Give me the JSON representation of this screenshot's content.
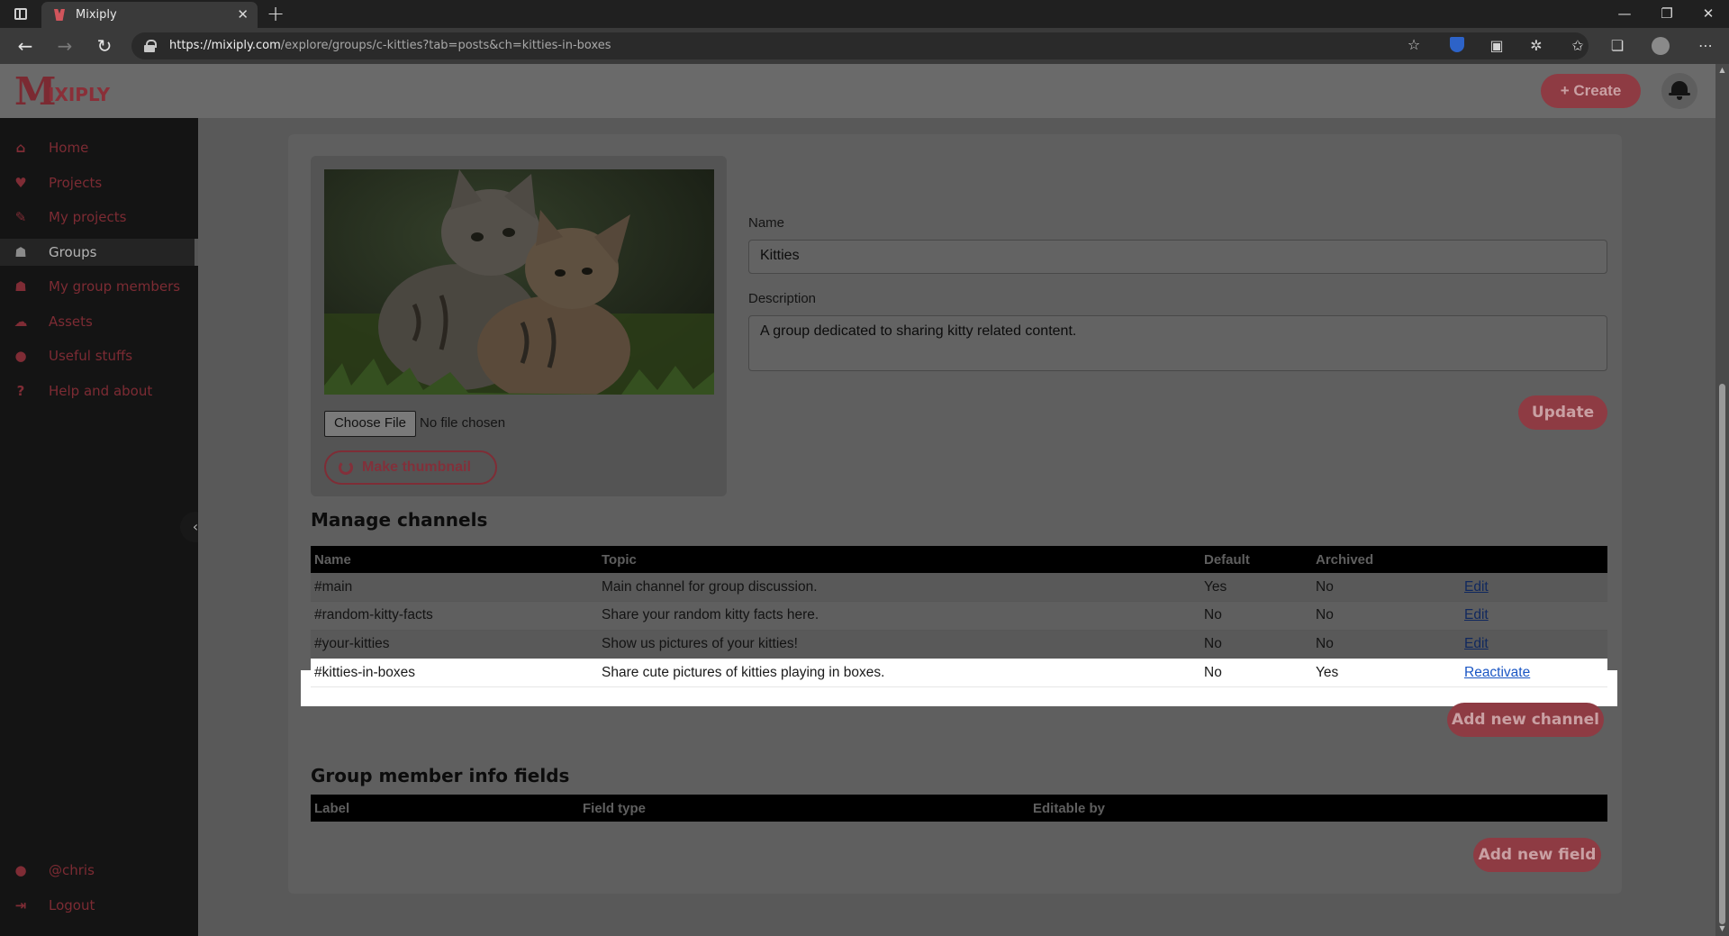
{
  "browser": {
    "tab_title": "Mixiply",
    "url_host": "https://mixiply.com",
    "url_path": "/explore/groups/c-kitties?tab=posts&ch=kitties-in-boxes"
  },
  "header": {
    "logo_initial": "M",
    "logo_rest": "IXIPLY",
    "create_label": "+ Create"
  },
  "sidebar": {
    "items": [
      {
        "label": "Home",
        "icon": "home-icon",
        "glyph": "⌂"
      },
      {
        "label": "Projects",
        "icon": "heart-icon",
        "glyph": "♥"
      },
      {
        "label": "My projects",
        "icon": "brush-icon",
        "glyph": "✎"
      },
      {
        "label": "Groups",
        "icon": "users-icon",
        "glyph": "☗"
      },
      {
        "label": "My group members",
        "icon": "group-icon",
        "glyph": "☗"
      },
      {
        "label": "Assets",
        "icon": "cloud-icon",
        "glyph": "☁"
      },
      {
        "label": "Useful stuffs",
        "icon": "lightbulb-icon",
        "glyph": "●"
      },
      {
        "label": "Help and about",
        "icon": "question-icon",
        "glyph": "?"
      }
    ],
    "user": {
      "label": "@chris",
      "icon": "user-icon",
      "glyph": "●"
    },
    "logout": {
      "label": "Logout",
      "icon": "logout-icon",
      "glyph": "⇥"
    }
  },
  "group_form": {
    "file_button": "Choose File",
    "file_status": "No file chosen",
    "thumbnail_button": "Make thumbnail",
    "name_label": "Name",
    "name_value": "Kitties",
    "description_label": "Description",
    "description_value": "A group dedicated to sharing kitty related content.",
    "update_button": "Update"
  },
  "channels": {
    "title": "Manage channels",
    "headers": [
      "Name",
      "Topic",
      "Default",
      "Archived",
      ""
    ],
    "rows": [
      {
        "name": "#main",
        "topic": "Main channel for group discussion.",
        "default": "Yes",
        "archived": "No",
        "action": "Edit"
      },
      {
        "name": "#random-kitty-facts",
        "topic": "Share your random kitty facts here.",
        "default": "No",
        "archived": "No",
        "action": "Edit"
      },
      {
        "name": "#your-kitties",
        "topic": "Show us pictures of your kitties!",
        "default": "No",
        "archived": "No",
        "action": "Edit"
      },
      {
        "name": "#kitties-in-boxes",
        "topic": "Share cute pictures of kitties playing in boxes.",
        "default": "No",
        "archived": "Yes",
        "action": "Reactivate"
      }
    ],
    "add_button": "Add new channel"
  },
  "member_fields": {
    "title": "Group member info fields",
    "headers": [
      "Label",
      "Field type",
      "Editable by"
    ],
    "add_button": "Add new field"
  },
  "colors": {
    "accent": "#8e3b43",
    "sidebar_bg": "#141414",
    "highlight": "#ffffff",
    "link": "#1a56c4"
  }
}
